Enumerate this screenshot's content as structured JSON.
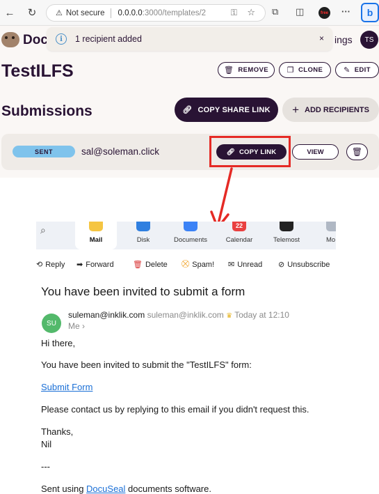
{
  "browser": {
    "security_label": "Not secure",
    "url_host": "0.0.0.0",
    "url_path": ":3000/templates/2",
    "free_badge": "free"
  },
  "header": {
    "brand": "Docu",
    "settings_partial": "ings",
    "avatar_initials": "TS"
  },
  "toast": {
    "message": "1 recipient added",
    "close": "×"
  },
  "template": {
    "title": "TestILFS",
    "remove_label": "REMOVE",
    "clone_label": "CLONE",
    "edit_label": "EDIT"
  },
  "submissions": {
    "heading": "Submissions",
    "copy_share_link_label": "COPY SHARE LINK",
    "add_recipients_label": "ADD RECIPIENTS",
    "rows": [
      {
        "status": "SENT",
        "email": "sal@soleman.click",
        "copy_link_label": "COPY LINK",
        "view_label": "VIEW"
      }
    ]
  },
  "annotation": {
    "highlight_color": "#e52a25"
  },
  "mail_client": {
    "tabs": [
      {
        "label": "Mail",
        "color": "#f5c542"
      },
      {
        "label": "Disk",
        "color": "#2f7fe0"
      },
      {
        "label": "Documents",
        "color": "#3b82f6"
      },
      {
        "label": "Calendar",
        "color": "#e94040"
      },
      {
        "label": "Telemost",
        "color": "#222222"
      },
      {
        "label": "Mo",
        "color": "#b0b8c4"
      }
    ],
    "calendar_day": "22",
    "toolbar": {
      "reply": "Reply",
      "forward": "Forward",
      "delete": "Delete",
      "spam": "Spam!",
      "unread": "Unread",
      "unsubscribe": "Unsubscribe"
    },
    "message": {
      "subject": "You have been invited to submit a form",
      "avatar_initials": "SU",
      "sender_name": "suleman@inklik.com",
      "sender_email": "suleman@inklik.com",
      "time": "Today at 12:10",
      "recipient": "Me ›",
      "greeting": "Hi there,",
      "line_invite": "You have been invited to submit the \"TestILFS\" form:",
      "link_text": "Submit Form",
      "line_contact": "Please contact us by replying to this email if you didn't request this.",
      "thanks": "Thanks,",
      "signature": "Nil",
      "divider": "---",
      "footer_prefix": "Sent using ",
      "footer_link": "DocuSeal",
      "footer_suffix": " documents software."
    }
  }
}
